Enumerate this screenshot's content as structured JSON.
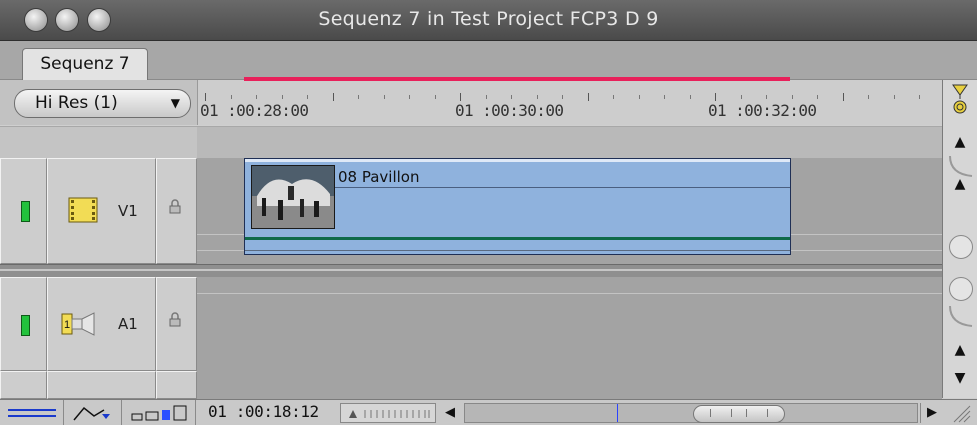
{
  "window": {
    "title": "Sequenz 7 in Test Project FCP3 D 9"
  },
  "tabs": [
    {
      "label": "Sequenz 7"
    }
  ],
  "ruler": {
    "resolution": "Hi Res  (1)",
    "timecodes": [
      "01 :00:28:00",
      "01 :00:30:00",
      "01 :00:32:00"
    ]
  },
  "tracks": {
    "video": {
      "label": "V1"
    },
    "audio": {
      "label": "A1"
    }
  },
  "clip": {
    "name": "08 Pavillon"
  },
  "bottom": {
    "timecode": "01 :00:18:12"
  },
  "colors": {
    "accent_red": "#e8205a",
    "clip_blue": "#8fb2dd",
    "track_green": "#22c23c"
  }
}
